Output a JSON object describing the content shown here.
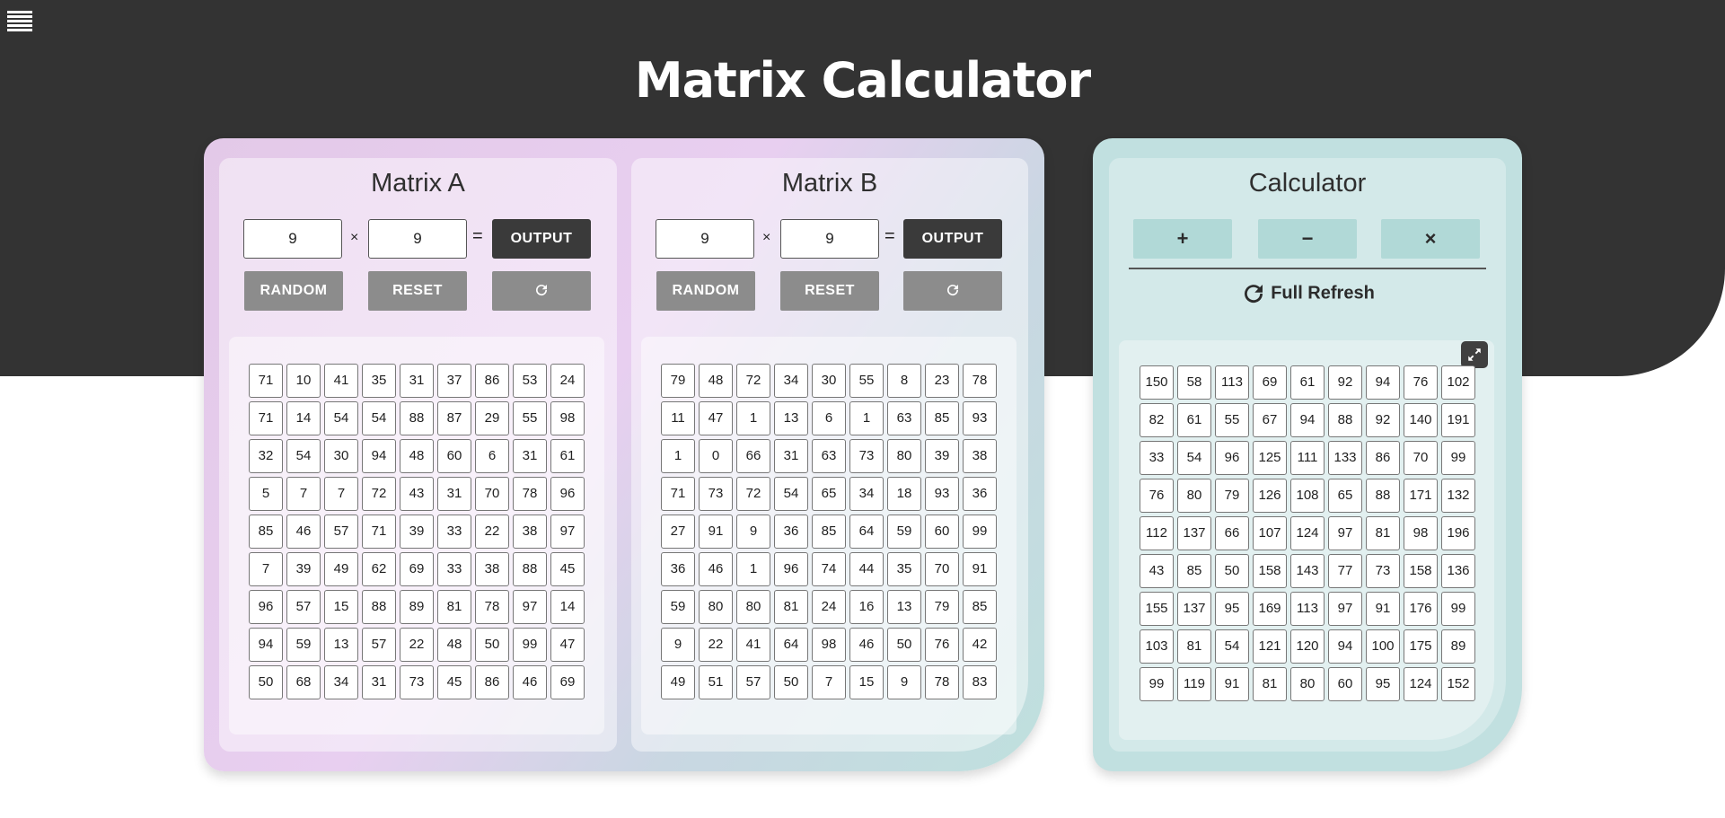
{
  "page": {
    "title": "Matrix Calculator"
  },
  "matrix_a": {
    "title": "Matrix A",
    "rows": "9",
    "cols": "9",
    "times_sign": "×",
    "equals_sign": "=",
    "output_label": "OUTPUT",
    "random_label": "RANDOM",
    "reset_label": "RESET",
    "refresh_icon": "refresh-icon",
    "values": [
      [
        71,
        10,
        41,
        35,
        31,
        37,
        86,
        53,
        24
      ],
      [
        71,
        14,
        54,
        54,
        88,
        87,
        29,
        55,
        98
      ],
      [
        32,
        54,
        30,
        94,
        48,
        60,
        6,
        31,
        61
      ],
      [
        5,
        7,
        7,
        72,
        43,
        31,
        70,
        78,
        96
      ],
      [
        85,
        46,
        57,
        71,
        39,
        33,
        22,
        38,
        97
      ],
      [
        7,
        39,
        49,
        62,
        69,
        33,
        38,
        88,
        45
      ],
      [
        96,
        57,
        15,
        88,
        89,
        81,
        78,
        97,
        14
      ],
      [
        94,
        59,
        13,
        57,
        22,
        48,
        50,
        99,
        47
      ],
      [
        50,
        68,
        34,
        31,
        73,
        45,
        86,
        46,
        69
      ]
    ]
  },
  "matrix_b": {
    "title": "Matrix B",
    "rows": "9",
    "cols": "9",
    "times_sign": "×",
    "equals_sign": "=",
    "output_label": "OUTPUT",
    "random_label": "RANDOM",
    "reset_label": "RESET",
    "refresh_icon": "refresh-icon",
    "values": [
      [
        79,
        48,
        72,
        34,
        30,
        55,
        8,
        23,
        78
      ],
      [
        11,
        47,
        1,
        13,
        6,
        1,
        63,
        85,
        93
      ],
      [
        1,
        0,
        66,
        31,
        63,
        73,
        80,
        39,
        38
      ],
      [
        71,
        73,
        72,
        54,
        65,
        34,
        18,
        93,
        36
      ],
      [
        27,
        91,
        9,
        36,
        85,
        64,
        59,
        60,
        99
      ],
      [
        36,
        46,
        1,
        96,
        74,
        44,
        35,
        70,
        91
      ],
      [
        59,
        80,
        80,
        81,
        24,
        16,
        13,
        79,
        85
      ],
      [
        9,
        22,
        41,
        64,
        98,
        46,
        50,
        76,
        42
      ],
      [
        49,
        51,
        57,
        50,
        7,
        15,
        9,
        78,
        83
      ]
    ]
  },
  "calculator": {
    "title": "Calculator",
    "add_label": "+",
    "subtract_label": "−",
    "multiply_label": "×",
    "full_refresh_label": "Full Refresh",
    "expand_icon": "expand-icon",
    "result": [
      [
        150,
        58,
        113,
        69,
        61,
        92,
        94,
        76,
        102
      ],
      [
        82,
        61,
        55,
        67,
        94,
        88,
        92,
        140,
        191
      ],
      [
        33,
        54,
        96,
        125,
        111,
        133,
        86,
        70,
        99
      ],
      [
        76,
        80,
        79,
        126,
        108,
        65,
        88,
        171,
        132
      ],
      [
        112,
        137,
        66,
        107,
        124,
        97,
        81,
        98,
        196
      ],
      [
        43,
        85,
        50,
        158,
        143,
        77,
        73,
        158,
        136
      ],
      [
        155,
        137,
        95,
        169,
        113,
        97,
        91,
        176,
        99
      ],
      [
        103,
        81,
        54,
        121,
        120,
        94,
        100,
        175,
        89
      ],
      [
        99,
        119,
        91,
        81,
        80,
        60,
        95,
        124,
        152
      ]
    ]
  },
  "colors": {
    "header_bg": "#333333",
    "accent_dark": "#3a3a3a",
    "button_gray": "#8c8c8c",
    "calc_bg": "#c1e0e0",
    "op_button": "#b1d9d7"
  }
}
